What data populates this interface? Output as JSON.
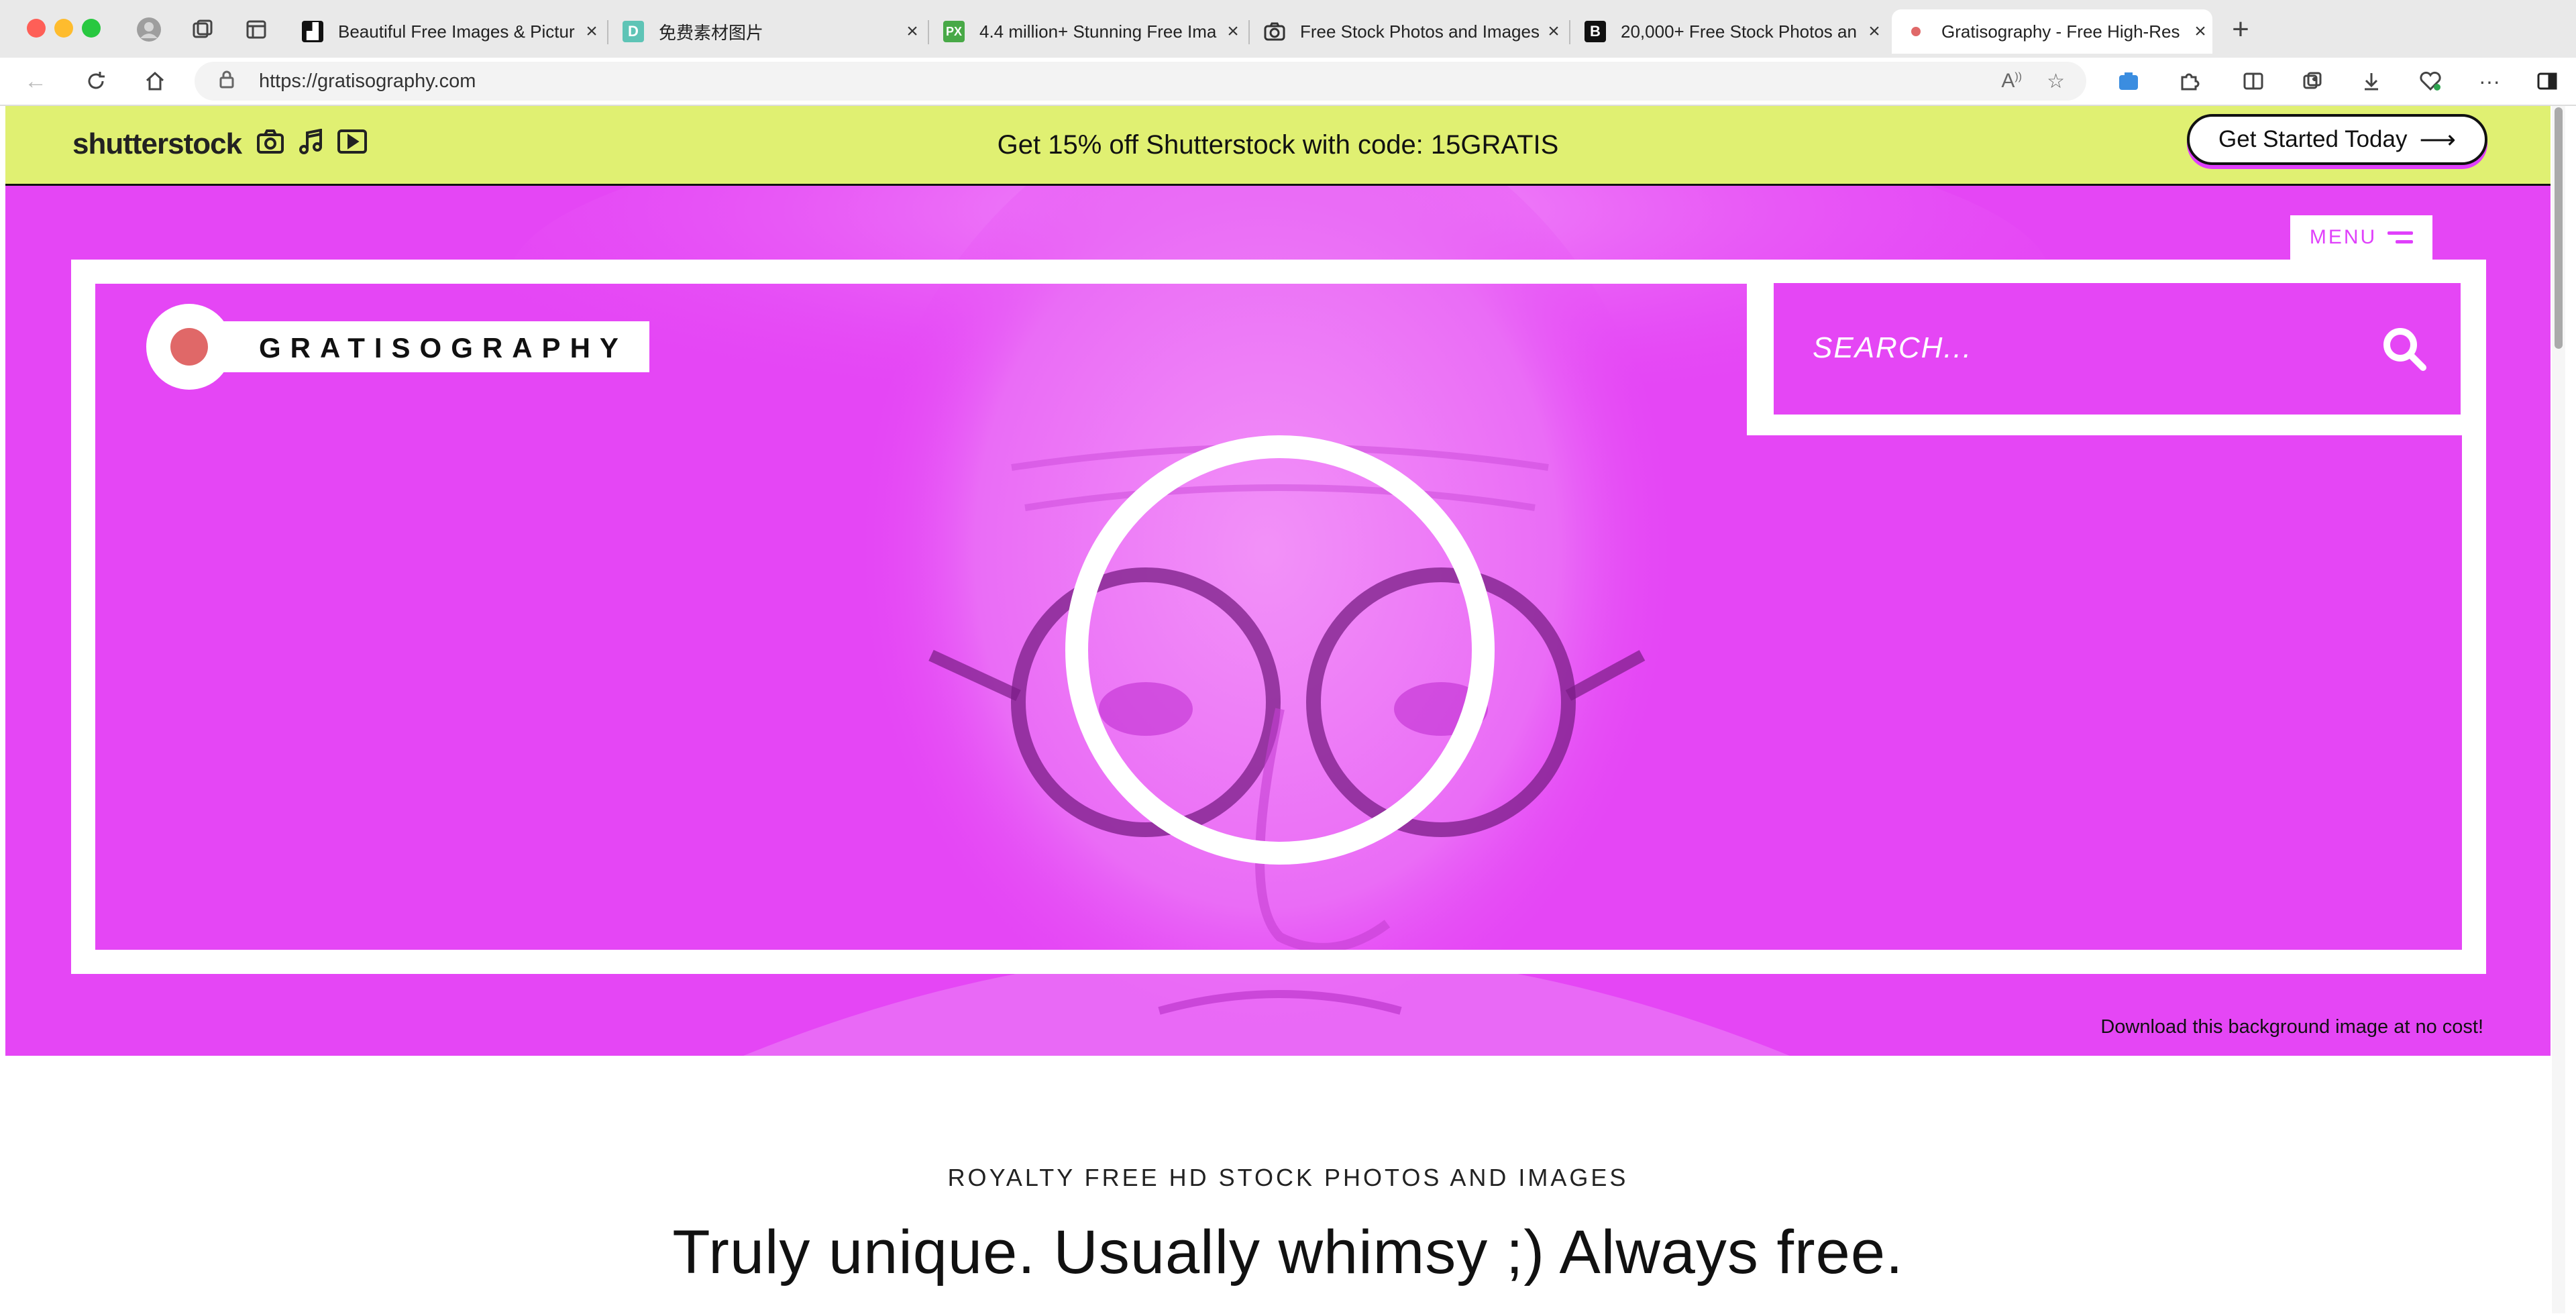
{
  "browser": {
    "tabs": [
      {
        "title": "Beautiful Free Images & Pictur",
        "favicon": "unsplash-icon",
        "close": "×"
      },
      {
        "title": "免费素材图片",
        "favicon": "D",
        "close": "×"
      },
      {
        "title": "4.4 million+ Stunning Free Ima",
        "favicon": "PX",
        "close": "×"
      },
      {
        "title": "Free Stock Photos and Images",
        "favicon": "camera-icon",
        "close": "×"
      },
      {
        "title": "20,000+ Free Stock Photos an",
        "favicon": "B",
        "close": "×"
      },
      {
        "title": "Gratisography - Free High-Res",
        "favicon": "red-dot-icon",
        "close": "×",
        "active": true
      }
    ],
    "new_tab": "+",
    "url": "https://gratisography.com"
  },
  "promo": {
    "brand": "shutterstock",
    "text": "Get 15% off Shutterstock with code: 15GRATIS",
    "cta": "Get Started Today",
    "cta_arrow": "⟶"
  },
  "hero": {
    "menu": "MENU",
    "logo": "GRATISOGRAPHY",
    "search_placeholder": "SEARCH...",
    "download_note": "Download this background image at no cost!",
    "accent_color": "#e546f5",
    "logo_dot_color": "#e06868"
  },
  "main": {
    "subheading": "ROYALTY FREE HD STOCK PHOTOS AND IMAGES",
    "heading": "Truly unique. Usually whimsy ;) Always free."
  }
}
